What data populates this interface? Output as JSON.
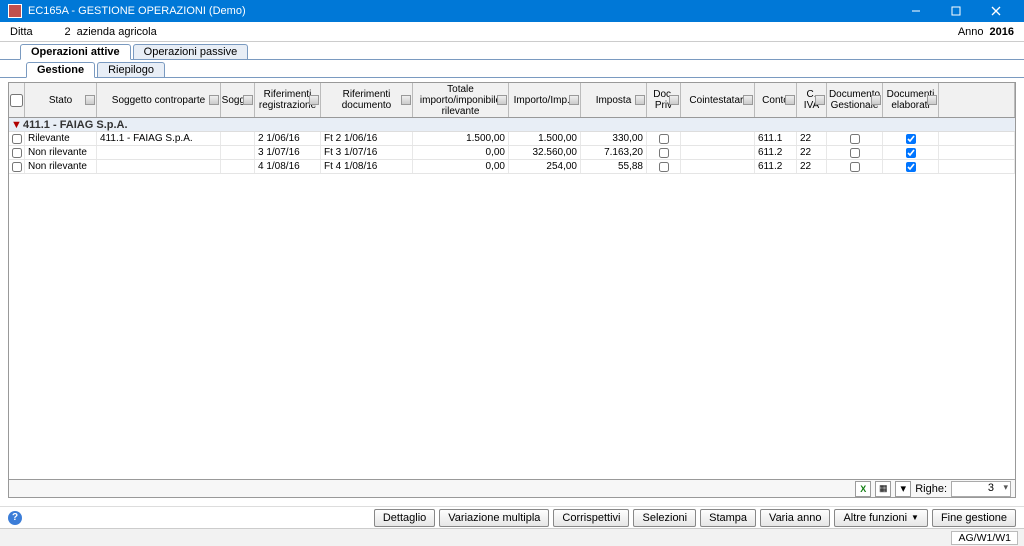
{
  "window": {
    "title": "EC165A - GESTIONE OPERAZIONI (Demo)"
  },
  "header": {
    "ditta_label": "Ditta",
    "ditta_num": "2",
    "ditta_name": "azienda agricola",
    "anno_label": "Anno",
    "anno_value": "2016"
  },
  "tabs_top": {
    "active": "Operazioni attive",
    "inactive": "Operazioni passive"
  },
  "tabs_sub": {
    "active": "Gestione",
    "inactive": "Riepilogo"
  },
  "columns": {
    "stato": "Stato",
    "soggetto": "Soggetto controparte",
    "soggx": "Sogg...",
    "reg": "Riferimenti registrazione",
    "doc": "Riferimenti documento",
    "tot": "Totale importo/imponibile rilevante",
    "imp": "Importo/Imp...",
    "iva": "Imposta",
    "priv": "Doc. Priv",
    "coint": "Cointestatari",
    "conto": "Conto",
    "civa": "C. IVA",
    "ges": "Documento Gestionale",
    "elab": "Documenti elaborati"
  },
  "group": {
    "label": "411.1 - FAIAG S.p.A."
  },
  "rows": [
    {
      "stato": "Rilevante",
      "soggetto": "411.1 - FAIAG S.p.A.",
      "reg": "2  1/06/16",
      "doc": "Ft 2  1/06/16",
      "tot": "1.500,00",
      "imp": "1.500,00",
      "iva": "330,00",
      "priv": false,
      "conto": "611.1",
      "civa": "22",
      "ges": false,
      "elab": true
    },
    {
      "stato": "Non rilevante",
      "soggetto": "",
      "reg": "3  1/07/16",
      "doc": "Ft 3  1/07/16",
      "tot": "0,00",
      "imp": "32.560,00",
      "iva": "7.163,20",
      "priv": false,
      "conto": "611.2",
      "civa": "22",
      "ges": false,
      "elab": true
    },
    {
      "stato": "Non rilevante",
      "soggetto": "",
      "reg": "4  1/08/16",
      "doc": "Ft 4  1/08/16",
      "tot": "0,00",
      "imp": "254,00",
      "iva": "55,88",
      "priv": false,
      "conto": "611.2",
      "civa": "22",
      "ges": false,
      "elab": true
    }
  ],
  "grid_footer": {
    "righe_label": "Righe:",
    "righe_value": "3"
  },
  "buttons": {
    "dettaglio": "Dettaglio",
    "variazione": "Variazione multipla",
    "corrispettivi": "Corrispettivi",
    "selezioni": "Selezioni",
    "stampa": "Stampa",
    "varia_anno": "Varia anno",
    "altre": "Altre funzioni",
    "fine": "Fine gestione"
  },
  "status": {
    "text": "AG/W1/W1"
  }
}
